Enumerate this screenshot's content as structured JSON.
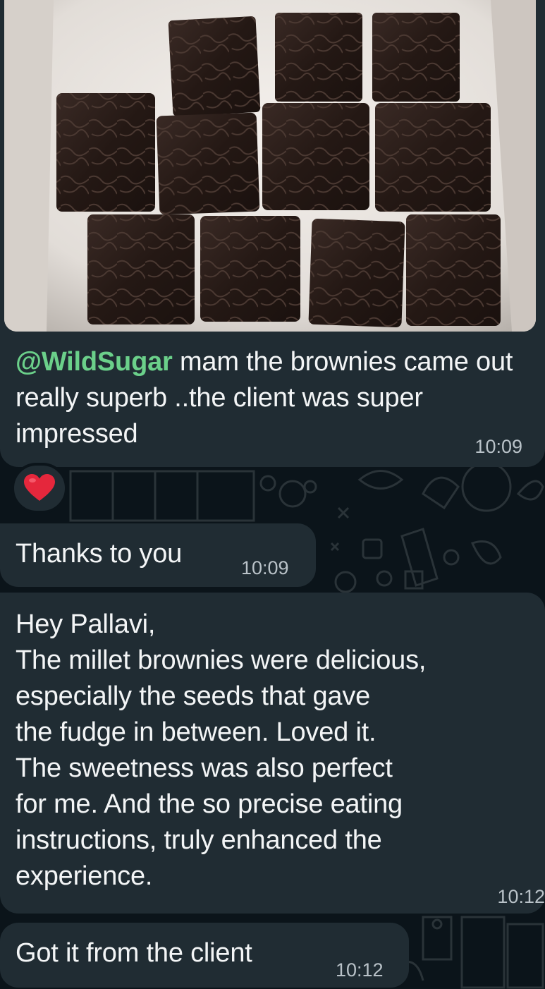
{
  "messages": [
    {
      "mention": "@WildSugar",
      "text": " mam the brownies came out really superb ..the client was super impressed",
      "time": "10:09",
      "reaction": "❤️"
    },
    {
      "text": "Thanks to you",
      "time": "10:09"
    },
    {
      "lines": [
        "Hey Pallavi,",
        "The millet brownies were delicious,",
        "especially the seeds that gave",
        "the fudge in between. Loved it.",
        "The sweetness was also perfect",
        "for me. And the so precise eating",
        "instructions, truly enhanced the",
        "experience."
      ],
      "time": "10:12"
    },
    {
      "text": "Got it from the client",
      "time": "10:12"
    }
  ],
  "colors": {
    "background": "#0b141a",
    "bubble": "#202c33",
    "mention": "#6bd08a",
    "timestamp": "#b9c2c8"
  },
  "photo": {
    "brownie_count": 11
  }
}
